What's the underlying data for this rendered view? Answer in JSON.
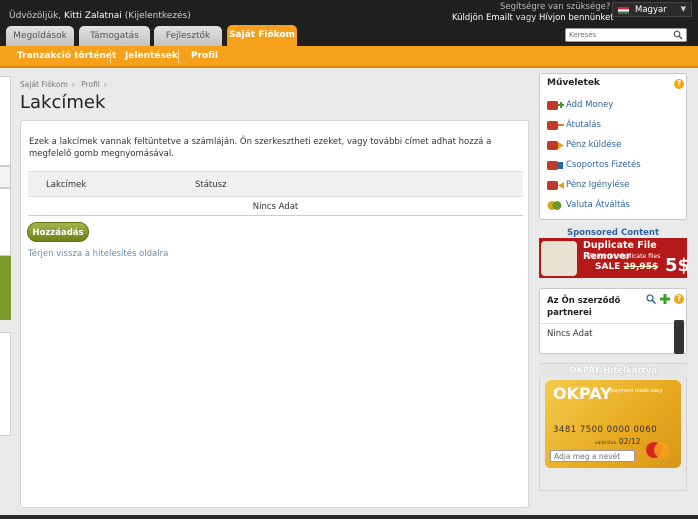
{
  "header": {
    "welcome_prefix": "Üdvözöljük,",
    "user_name": "Kitti Zalatnai",
    "logout": "(Kijelentkezés)",
    "help_question": "Segítségre van szüksége?",
    "send_email": "Küldjön Emailt",
    "or": "vagy",
    "call_us": "Hívjon bennünket",
    "language": "Magyar",
    "search_placeholder": "Keresés"
  },
  "tabs": [
    {
      "label": "Megoldások"
    },
    {
      "label": "Támogatás"
    },
    {
      "label": "Fejlesztők"
    },
    {
      "label": "Saját Fiókom",
      "active": true
    }
  ],
  "subnav": [
    {
      "label": "Tranzakció történet"
    },
    {
      "label": "Jelentések"
    },
    {
      "label": "Profil"
    }
  ],
  "breadcrumb": [
    "Saját Fiókom",
    "Profil"
  ],
  "page_title": "Lakcímek",
  "intro_text": "Ezek a lakcímek vannak feltüntetve a számláján. Ön szerkesztheti ezeket, vagy további címet adhat hozzá a megfelelő gomb megnyomásával.",
  "table": {
    "columns": [
      "Lakcímek",
      "Státusz"
    ],
    "empty_text": "Nincs Adat"
  },
  "add_button": "Hozzáadás",
  "back_link": "Térjen vissza a hitelesítés oldalra",
  "operations": {
    "title": "Műveletek",
    "items": [
      {
        "label": "Add Money",
        "icon": "add-money-icon"
      },
      {
        "label": "Átutalás",
        "icon": "transfer-icon"
      },
      {
        "label": "Pénz küldése",
        "icon": "send-money-icon"
      },
      {
        "label": "Csoportos Fizetés",
        "icon": "mass-payment-icon"
      },
      {
        "label": "Pénz Igénylése",
        "icon": "request-money-icon"
      },
      {
        "label": "Valuta Átváltás",
        "icon": "currency-exchange-icon"
      }
    ]
  },
  "sponsored": {
    "title": "Sponsored Content",
    "ad_title": "Duplicate File Remover",
    "ad_sub": "Removes duplicate files",
    "ad_sale": "SALE",
    "ad_old_price": "29,95$",
    "ad_price": "5$"
  },
  "partners": {
    "title": "Az Ön szerződő partnerei",
    "empty_text": "Nincs Adat"
  },
  "okpay": {
    "title": "OKPAY Hitelkártya",
    "brand": "OKPAY",
    "brand_sub": "payment made easy",
    "card_number": "3481 7500 0000 0060",
    "valid_label": "valid thru",
    "expiry": "02/12",
    "name_placeholder": "Adja meg a nevét"
  },
  "colors": {
    "accent_orange": "#f5a11c",
    "header_dark": "#1f1f1f",
    "link_blue": "#2f64a3",
    "button_green": "#7a8c20"
  }
}
